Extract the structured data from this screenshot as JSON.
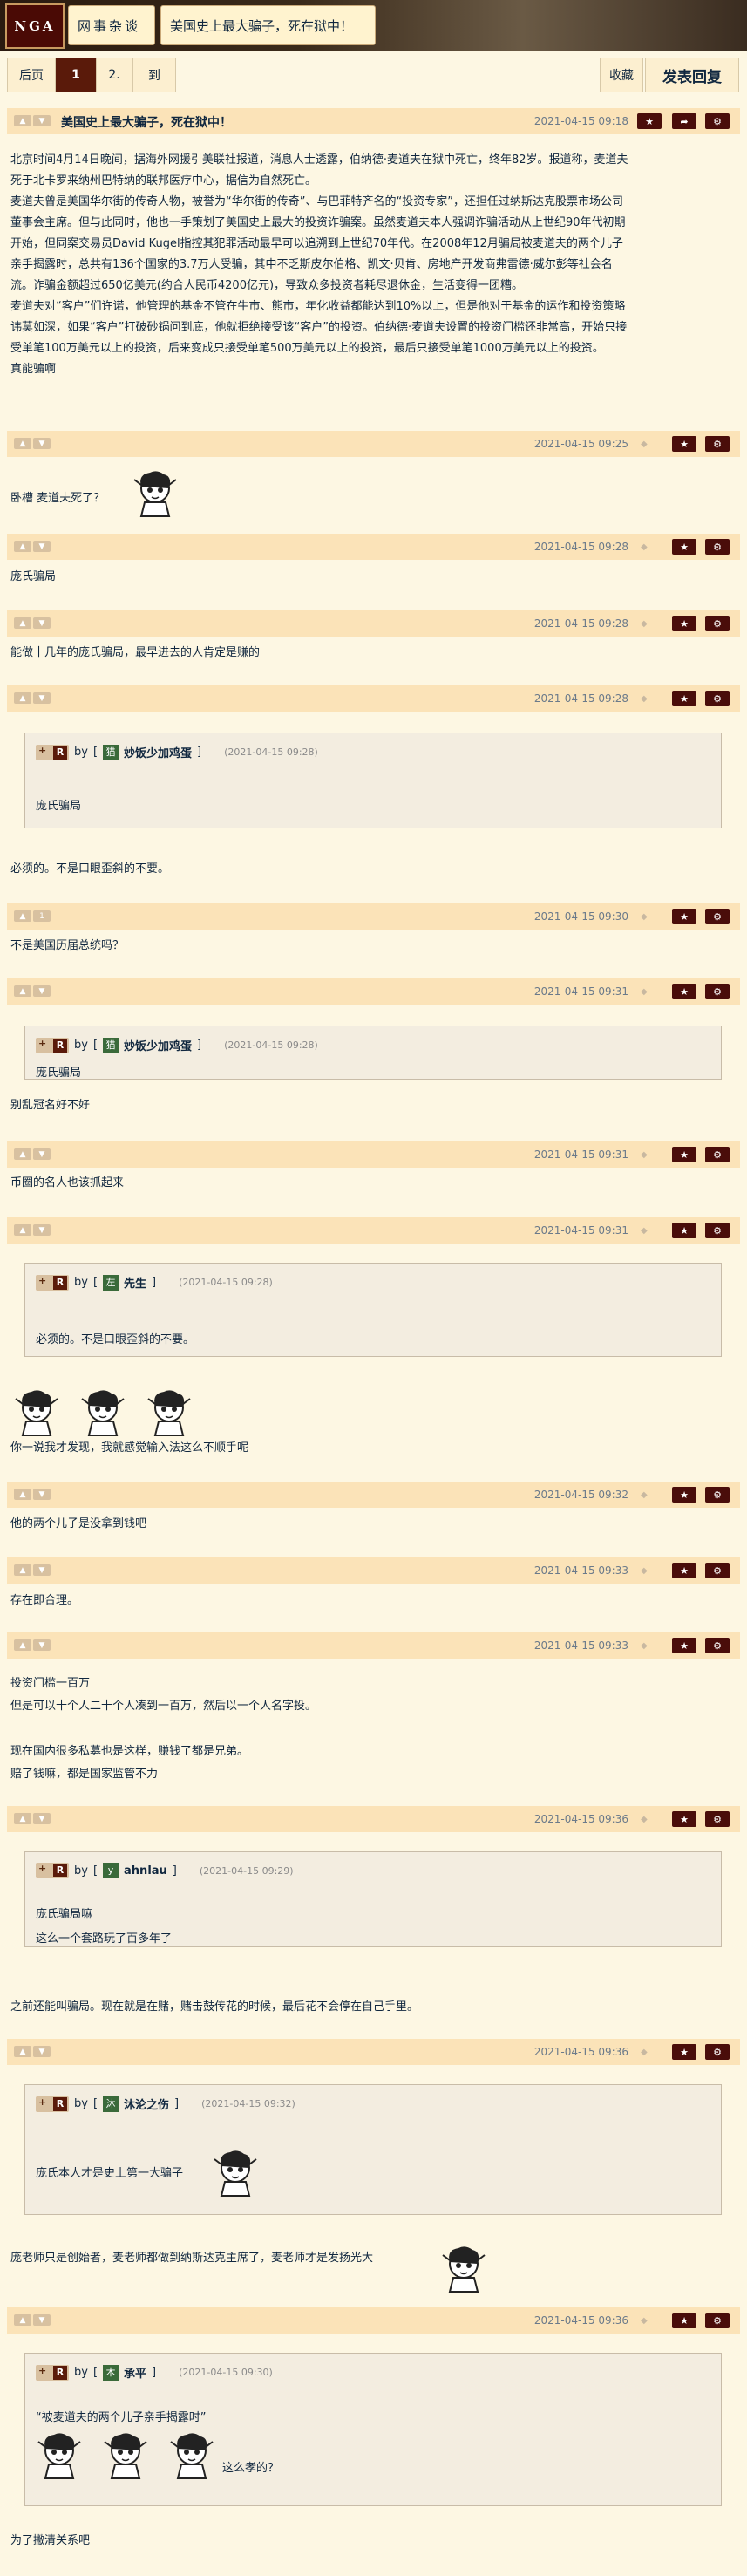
{
  "header": {
    "logo": "NGA",
    "forum": "网事杂谈",
    "thread_title": "美国史上最大骗子，死在狱中！"
  },
  "pager": {
    "prev": "后页",
    "page1": "1",
    "page2": "2.",
    "goto": "到",
    "favorite": "收藏",
    "reply": "发表回复"
  },
  "op": {
    "title": "美国史上最大骗子，死在狱中！",
    "time": "2021-04-15 09:18",
    "lines": [
      "北京时间4月14日晚间，据海外网援引美联社报道，消息人士透露，伯纳德·麦道夫在狱中死亡，终年82岁。报道称，麦道夫",
      "死于北卡罗来纳州巴特纳的联邦医疗中心，据信为自然死亡。",
      "麦道夫曾是美国华尔街的传奇人物，被誉为“华尔街的传奇”、与巴菲特齐名的“投资专家”，还担任过纳斯达克股票市场公司",
      "董事会主席。但与此同时，他也一手策划了美国史上最大的投资诈骗案。虽然麦道夫本人强调诈骗活动从上世纪90年代初期",
      "开始，但同案交易员David Kugel指控其犯罪活动最早可以追溯到上世纪70年代。在2008年12月骗局被麦道夫的两个儿子",
      "亲手揭露时，总共有136个国家的3.7万人受骗，其中不乏斯皮尔伯格、凯文·贝肯、房地产开发商弗雷德·威尔彭等社会名",
      "流。诈骗金额超过650亿美元(约合人民币4200亿元)，导致众多投资者耗尽退休金，生活变得一团糟。",
      "麦道夫对“客户”们许诺，他管理的基金不管在牛市、熊市，年化收益都能达到10%以上，但是他对于基金的运作和投资策略",
      "讳莫如深，如果“客户”打破砂锅问到底，他就拒绝接受该“客户”的投资。伯纳德·麦道夫设置的投资门槛还非常高，开始只接",
      "受单笔100万美元以上的投资，后来变成只接受单笔500万美元以上的投资，最后只接受单笔1000万美元以上的投资。",
      "真能骗啊"
    ]
  },
  "replies": [
    {
      "time": "2021-04-15 09:25",
      "text": "卧槽 麦道夫死了？"
    },
    {
      "time": "2021-04-15 09:28",
      "text": "庞氏骗局"
    },
    {
      "time": "2021-04-15 09:28",
      "text": "能做十几年的庞氏骗局，最早进去的人肯定是赚的"
    },
    {
      "time": "2021-04-15 09:28",
      "quote_name": "妙饭少加鸡蛋",
      "quote_avatar": "猫",
      "quote_time": "(2021-04-15 09:28)",
      "quote_text": "庞氏骗局",
      "text": "必须的。不是口眼歪斜的不要。"
    },
    {
      "time": "2021-04-15 09:30",
      "vote_count": "1",
      "text": "不是美国历届总统吗？"
    },
    {
      "time": "2021-04-15 09:31",
      "quote_name": "妙饭少加鸡蛋",
      "quote_avatar": "猫",
      "quote_time": "(2021-04-15 09:28)",
      "quote_text": "庞氏骗局",
      "text": "别乱冠名好不好"
    },
    {
      "time": "2021-04-15 09:31",
      "text": "币圈的名人也该抓起来"
    },
    {
      "time": "2021-04-15 09:31",
      "quote_name": "先生",
      "quote_avatar": "左",
      "quote_time": "(2021-04-15 09:28)",
      "quote_text": "必须的。不是口眼歪斜的不要。",
      "text": "你一说我才发现，我就感觉输入法这么不顺手呢"
    },
    {
      "time": "2021-04-15 09:32",
      "text": "他的两个儿子是没拿到钱吧"
    },
    {
      "time": "2021-04-15 09:33",
      "text": "存在即合理。"
    },
    {
      "time": "2021-04-15 09:33",
      "lines": [
        "投资门槛一百万",
        "但是可以十个人二十个人凑到一百万，然后以一个人名字投。",
        "",
        "现在国内很多私募也是这样，赚钱了都是兄弟。",
        "赔了钱嘛，都是国家监管不力"
      ]
    },
    {
      "time": "2021-04-15 09:36",
      "quote_name": "ahnlau",
      "quote_avatar": "y",
      "quote_time": "(2021-04-15 09:29)",
      "quote_lines": [
        "庞氏骗局嘛",
        "这么一个套路玩了百多年了"
      ],
      "text": "之前还能叫骗局。现在就是在赌，赌击鼓传花的时候，最后花不会停在自己手里。"
    },
    {
      "time": "2021-04-15 09:36",
      "quote_name": "沐沦之伤",
      "quote_avatar": "沐",
      "quote_time": "(2021-04-15 09:32)",
      "quote_text": "庞氏本人才是史上第一大骗子",
      "text": "庞老师只是创始者，麦老师都做到纳斯达克主席了，麦老师才是发扬光大"
    },
    {
      "time": "2021-04-15 09:36",
      "quote_name": "承平",
      "quote_avatar": "木",
      "quote_time": "(2021-04-15 09:30)",
      "quote_text": "“被麦道夫的两个儿子亲手揭露时”",
      "quote_tail": "这么孝的？",
      "text": "为了撇清关系吧"
    }
  ],
  "quote_by": "by",
  "colors": {
    "accent": "#4a0d0a",
    "head_bg": "#fbe3b8",
    "body_bg": "#fdf7e3"
  }
}
